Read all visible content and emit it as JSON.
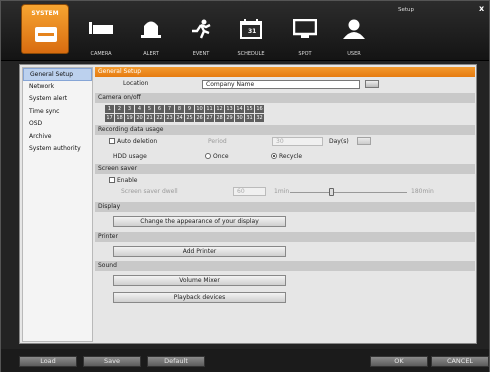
{
  "window": {
    "title": "Setup",
    "close_label": "x"
  },
  "system_tab": {
    "label": "SYSTEM"
  },
  "toolbar": [
    {
      "label": "CAMERA",
      "icon": "camera-icon"
    },
    {
      "label": "ALERT",
      "icon": "bell-icon"
    },
    {
      "label": "EVENT",
      "icon": "running-person-icon"
    },
    {
      "label": "SCHEDULE",
      "icon": "calendar-icon"
    },
    {
      "label": "SPOT",
      "icon": "monitor-icon"
    },
    {
      "label": "USER",
      "icon": "user-icon"
    }
  ],
  "schedule_day": "31",
  "sidebar": {
    "items": [
      {
        "label": "General Setup",
        "active": true
      },
      {
        "label": "Network"
      },
      {
        "label": "System alert"
      },
      {
        "label": "Time sync"
      },
      {
        "label": "OSD"
      },
      {
        "label": "Archive"
      },
      {
        "label": "System authority"
      }
    ]
  },
  "general": {
    "header": "General Setup",
    "location_label": "Location",
    "location_value": "Company Name"
  },
  "camera": {
    "header": "Camera on/off",
    "numbers": [
      "1",
      "2",
      "3",
      "4",
      "5",
      "6",
      "7",
      "8",
      "9",
      "10",
      "11",
      "12",
      "13",
      "14",
      "15",
      "16",
      "17",
      "18",
      "19",
      "20",
      "21",
      "22",
      "23",
      "24",
      "25",
      "26",
      "27",
      "28",
      "29",
      "30",
      "31",
      "32"
    ]
  },
  "recording": {
    "header": "Recording data usage",
    "auto_deletion": "Auto deletion",
    "period_label": "Period",
    "period_value": "30",
    "days_label": "Day(s)",
    "hdd_label": "HDD usage",
    "once": "Once",
    "recycle": "Recycle"
  },
  "screensaver": {
    "header": "Screen saver",
    "enable": "Enable",
    "dwell_label": "Screen saver dwell",
    "dwell_value": "60",
    "min_label": "1min",
    "max_label": "180min"
  },
  "display": {
    "header": "Display",
    "button": "Change the appearance of your display"
  },
  "printer": {
    "header": "Printer",
    "button": "Add Printer"
  },
  "sound": {
    "header": "Sound",
    "mixer_button": "Volume Mixer",
    "playback_button": "Playback devices"
  },
  "bottom": {
    "load": "Load",
    "save": "Save",
    "default": "Default",
    "ok": "OK",
    "cancel": "CANCEL"
  },
  "colors": {
    "accent": "#e8821a",
    "active_menu": "#bcd1ee"
  }
}
